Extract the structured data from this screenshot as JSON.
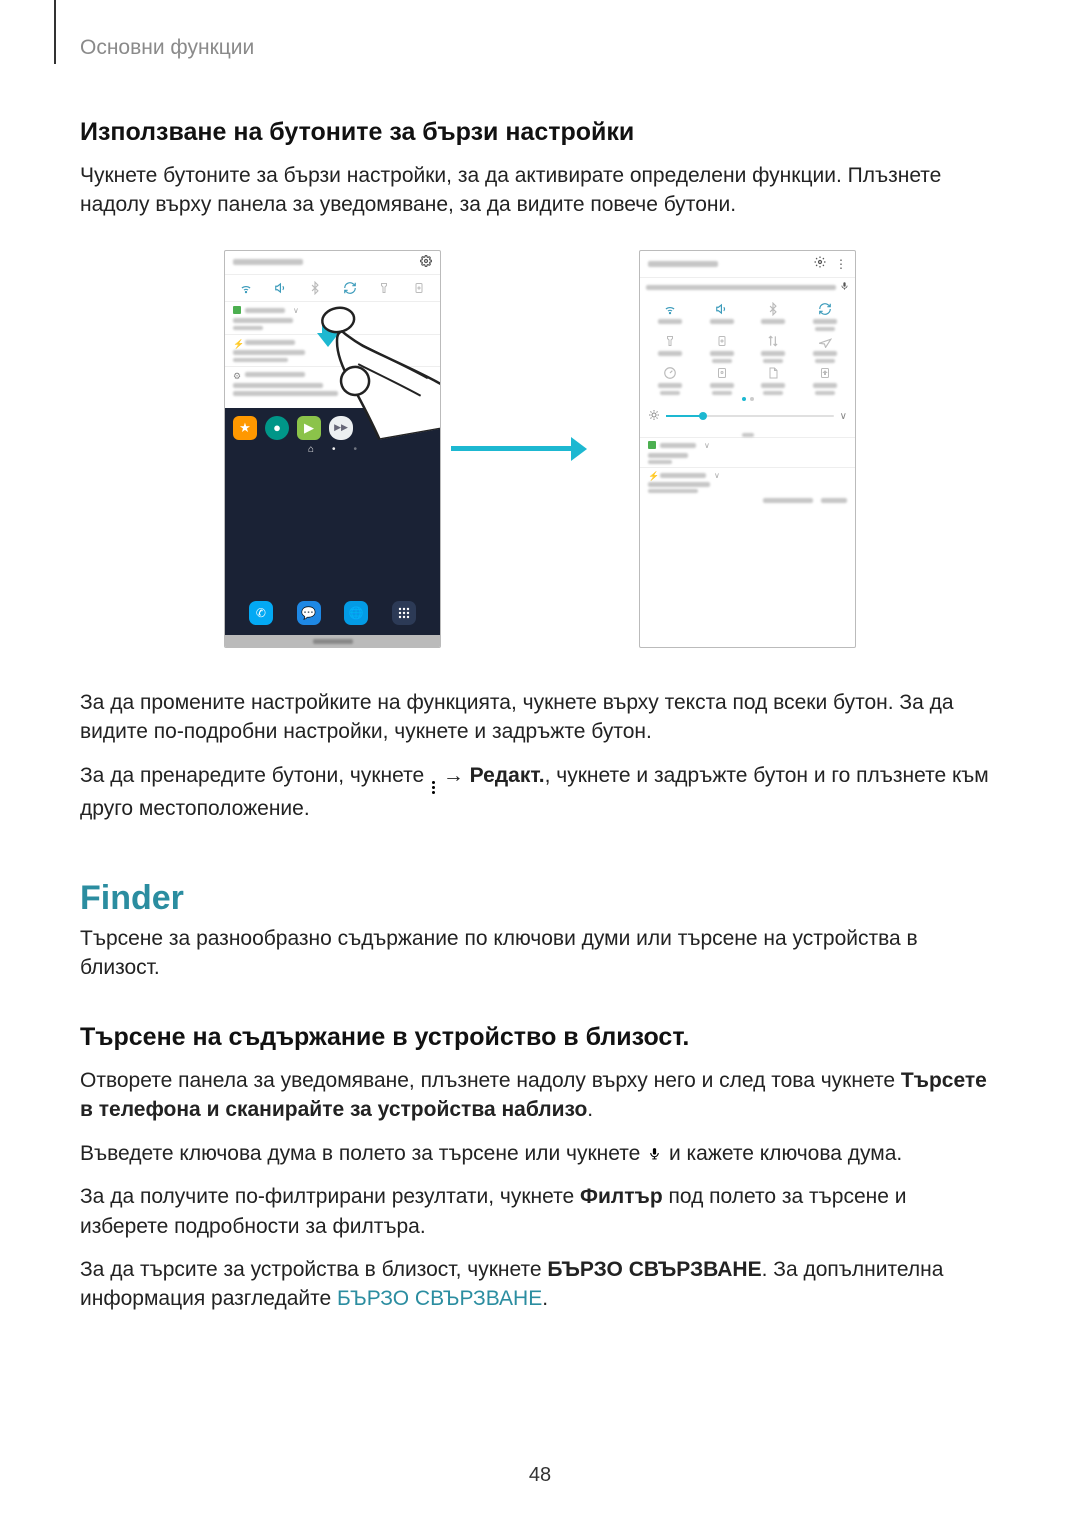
{
  "header": "Основни функции",
  "section1": {
    "title": "Използване на бутоните за бързи настройки",
    "p1": "Чукнете бутоните за бързи настройки, за да активирате определени функции. Плъзнете надолу върху панела за уведомяване, за да видите повече бутони.",
    "p2a": "За да промените настройките на функцията, чукнете върху текста под всеки бутон. За да видите по-подробни настройки, чукнете и задръжте бутон.",
    "p2b_pre": "За да пренаредите бутони, чукнете ",
    "p2b_arrow": " → ",
    "p2b_edit": "Редакт.",
    "p2b_post": ", чукнете и задръжте бутон и го плъзнете към друго местоположение."
  },
  "finder": {
    "title": "Finder",
    "p1": "Търсене за разнообразно съдържание по ключови думи или търсене на устройства в близост.",
    "subtitle": "Търсене на съдържание в устройство в близост.",
    "p2_pre": "Отворете панела за уведомяване, плъзнете надолу върху него и след това чукнете ",
    "p2_bold": "Търсете в телефона и сканирайте за устройства наблизо",
    "p2_post": ".",
    "p3_pre": "Въведете ключова дума в полето за търсене или чукнете ",
    "p3_post": " и кажете ключова дума.",
    "p4_pre": "За да получите по-филтрирани резултати, чукнете ",
    "p4_bold": "Филтър",
    "p4_post": " под полето за търсене и изберете подробности за филтъра.",
    "p5_pre": "За да търсите за устройства в близост, чукнете ",
    "p5_bold": "БЪРЗО СВЪРЗВАНЕ",
    "p5_mid": ". За допълнителна информация разгледайте ",
    "p5_link": "БЪРЗО СВЪРЗВАНЕ",
    "p5_post": "."
  },
  "page_number": "48"
}
